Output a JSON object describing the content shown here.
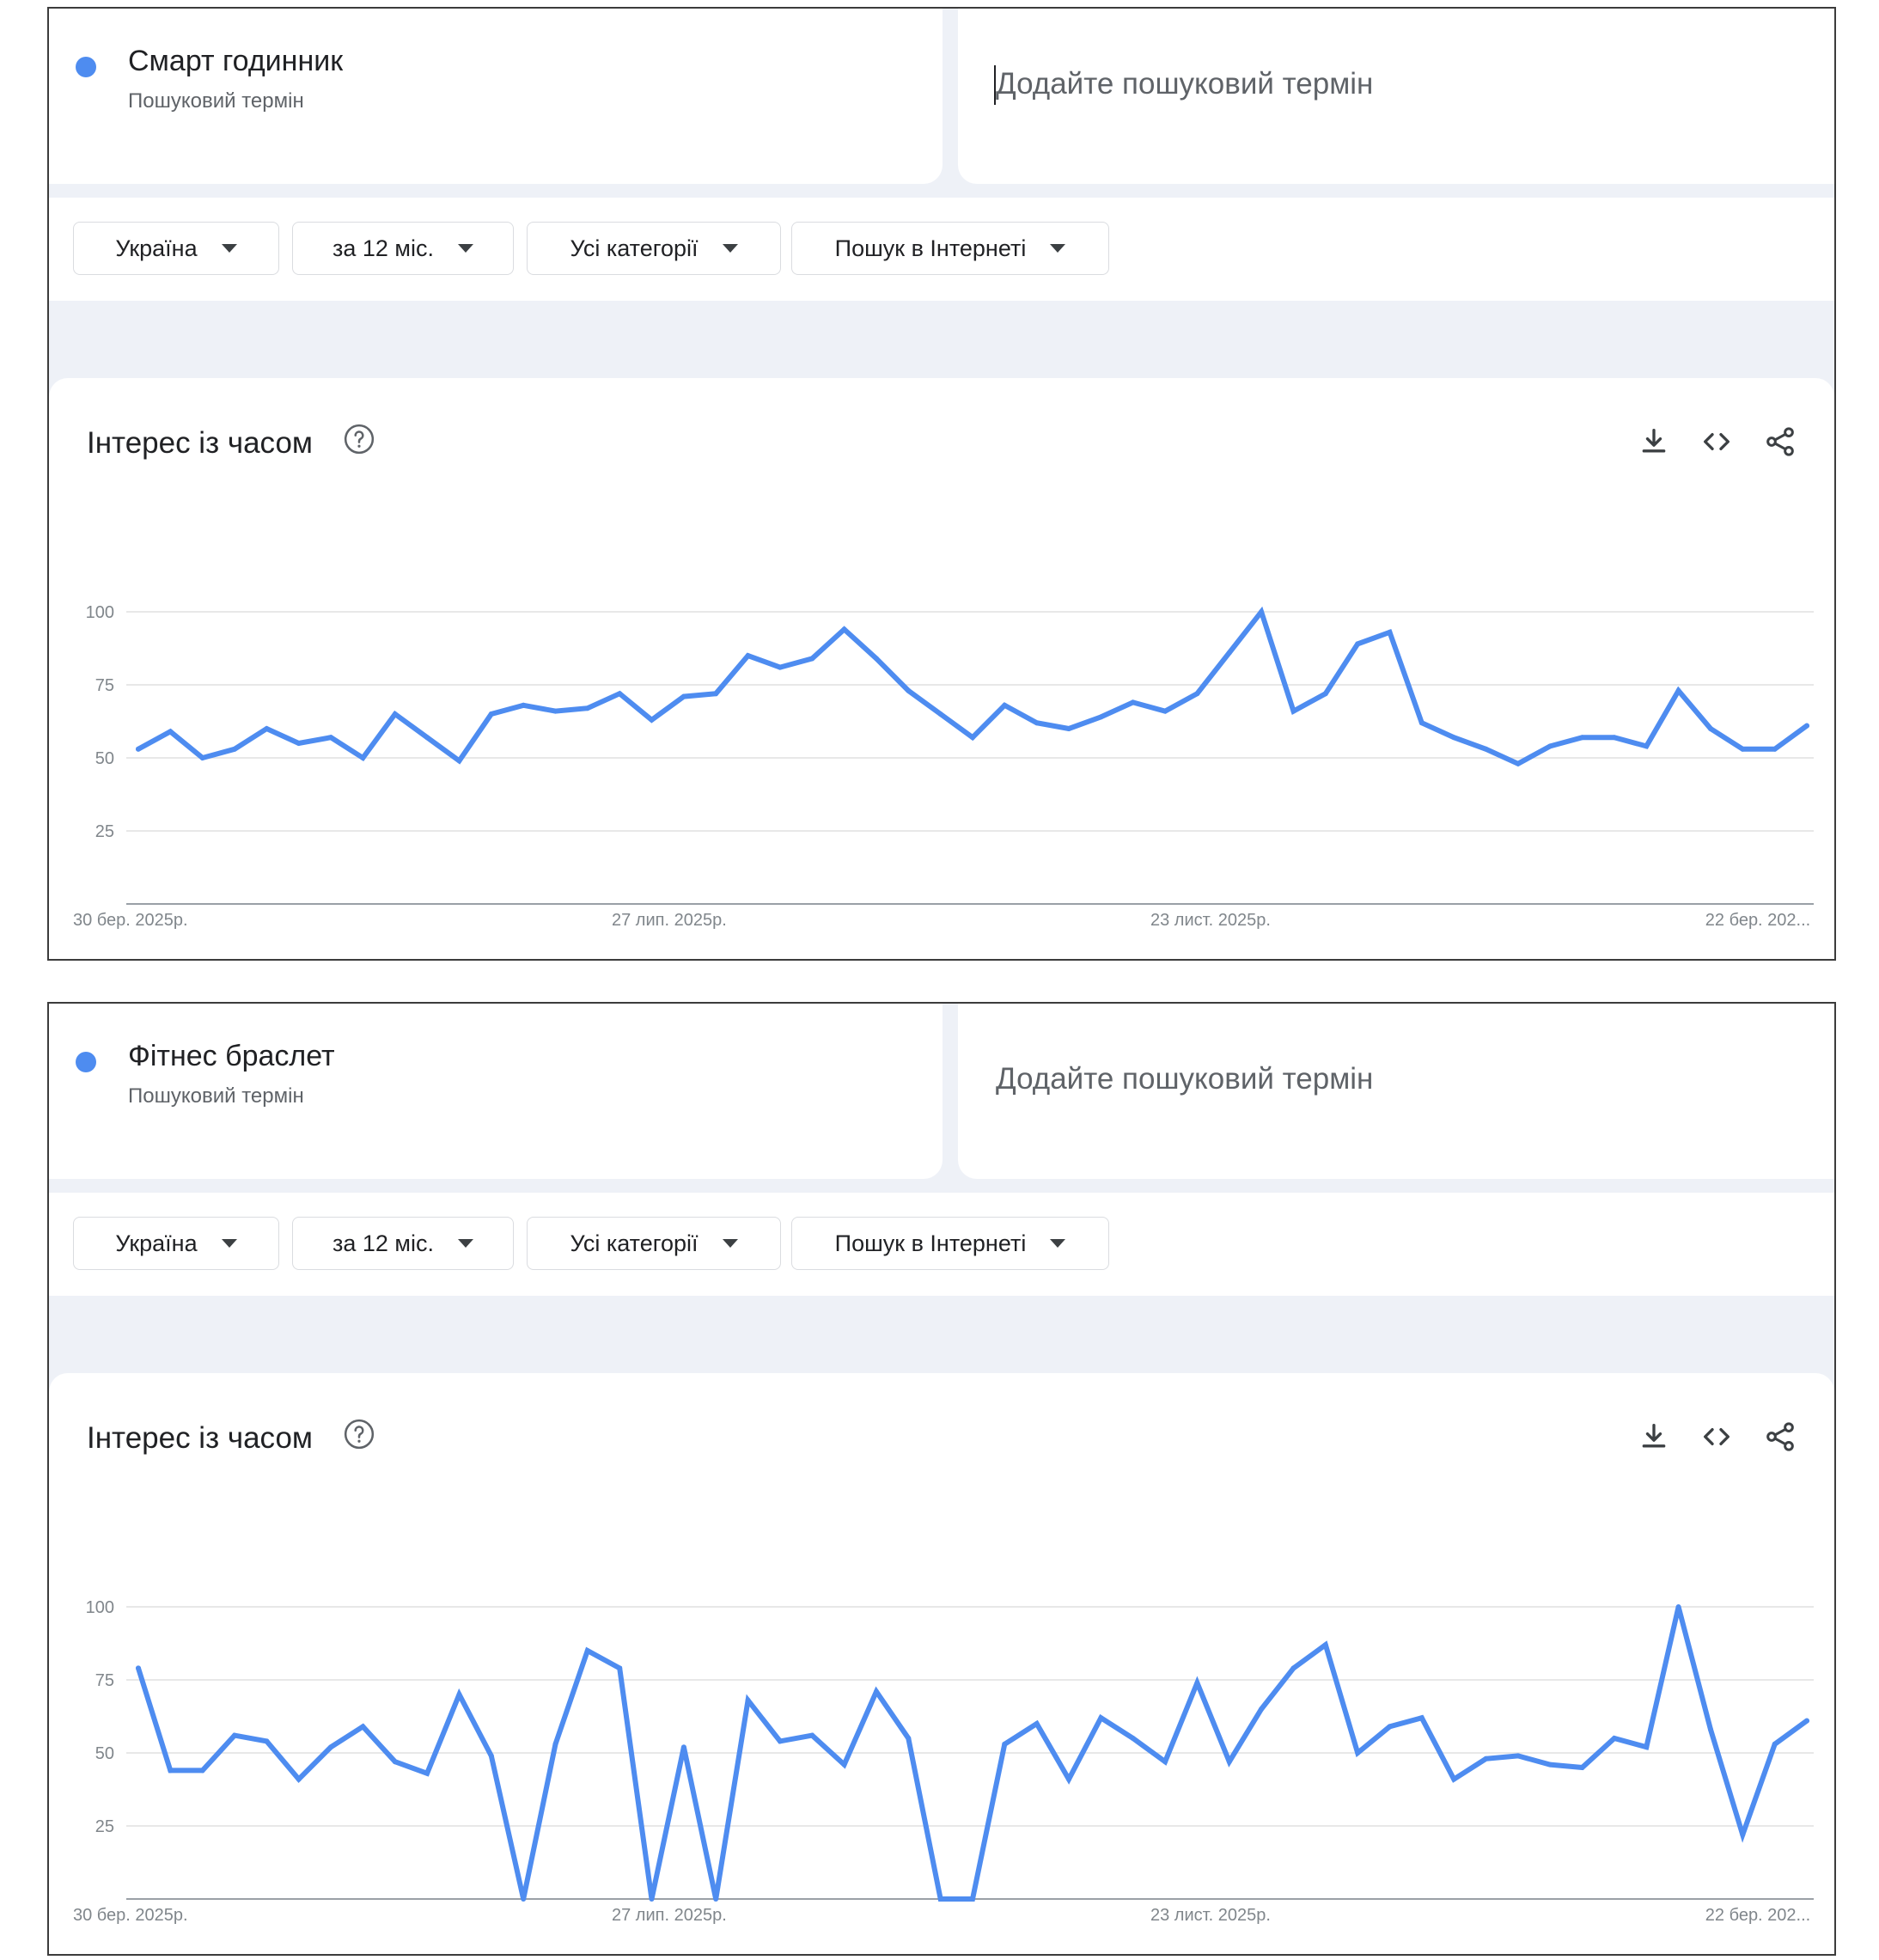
{
  "panels": [
    {
      "term": {
        "name": "Смарт годинник",
        "subtitle": "Пошуковий термін"
      },
      "add_placeholder": "Додайте пошуковий термін",
      "filters": [
        "Україна",
        "за 12 міс.",
        "Усі категорії",
        "Пошук в Інтернеті"
      ],
      "chart_title": "Інтерес із часом",
      "icons": [
        "help-icon",
        "download-icon",
        "embed-icon",
        "share-icon"
      ]
    },
    {
      "term": {
        "name": "Фітнес браслет",
        "subtitle": "Пошуковий термін"
      },
      "add_placeholder": "Додайте пошуковий термін",
      "filters": [
        "Україна",
        "за 12 міс.",
        "Усі категорії",
        "Пошук в Інтернеті"
      ],
      "chart_title": "Інтерес із часом",
      "icons": [
        "help-icon",
        "download-icon",
        "embed-icon",
        "share-icon"
      ]
    }
  ],
  "colors": {
    "series": "#4e8cf0",
    "dot": "#4e8cf0",
    "grid": "#e0e0e0",
    "background": "#eef1f7"
  },
  "chart_data": [
    {
      "type": "line",
      "y_ticks": [
        "100",
        "75",
        "50",
        "25"
      ],
      "x_labels": [
        "30 бер. 2025р.",
        "27 лип. 2025р.",
        "23 лист. 2025р.",
        "22 бер. 202..."
      ],
      "ylim": [
        0,
        100
      ],
      "grid": true,
      "series": [
        {
          "values": [
            53,
            59,
            50,
            53,
            60,
            55,
            57,
            50,
            65,
            57,
            49,
            65,
            68,
            66,
            67,
            72,
            63,
            71,
            72,
            85,
            81,
            84,
            94,
            84,
            73,
            65,
            57,
            68,
            62,
            60,
            64,
            69,
            66,
            72,
            86,
            100,
            66,
            72,
            89,
            93,
            62,
            57,
            53,
            48,
            54,
            57,
            57,
            54,
            73,
            60,
            53,
            53,
            61
          ]
        }
      ]
    },
    {
      "type": "line",
      "y_ticks": [
        "100",
        "75",
        "50",
        "25"
      ],
      "x_labels": [
        "30 бер. 2025р.",
        "27 лип. 2025р.",
        "23 лист. 2025р.",
        "22 бер. 202..."
      ],
      "ylim": [
        0,
        100
      ],
      "grid": true,
      "series": [
        {
          "values": [
            79,
            44,
            44,
            56,
            54,
            41,
            52,
            59,
            47,
            43,
            70,
            49,
            0,
            53,
            85,
            79,
            0,
            52,
            0,
            68,
            54,
            56,
            46,
            71,
            55,
            0,
            0,
            53,
            60,
            41,
            62,
            55,
            47,
            74,
            47,
            65,
            79,
            87,
            50,
            59,
            62,
            41,
            48,
            49,
            46,
            45,
            55,
            52,
            100,
            58,
            22,
            53,
            61
          ]
        }
      ]
    }
  ]
}
